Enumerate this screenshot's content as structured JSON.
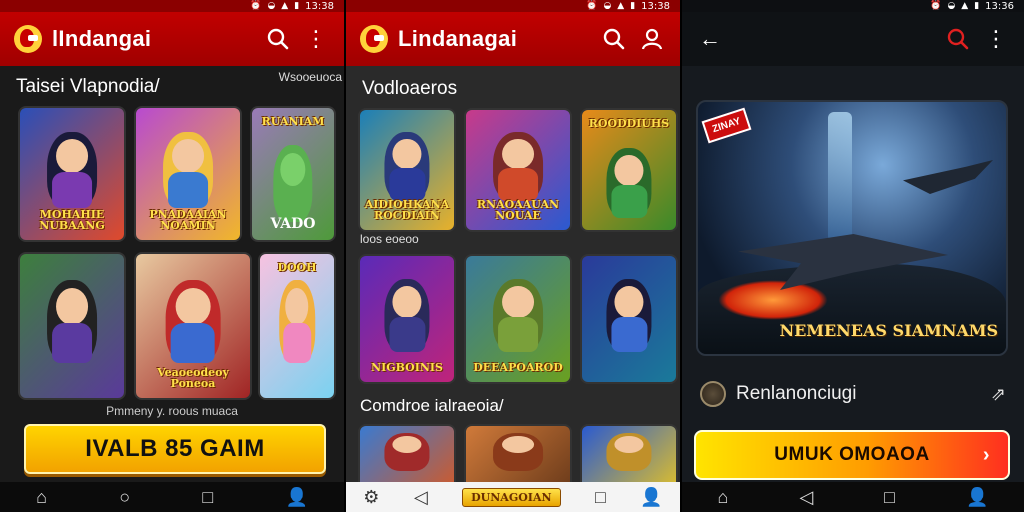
{
  "screen1": {
    "status_time": "13:38",
    "app_title": "lIndangai",
    "section_title": "Taisei Vlapnodia/",
    "side_label": "Wsooeuoca",
    "tiles": [
      {
        "title": "MOHAHIE NUBAANG",
        "colors": [
          "#2a4fb8",
          "#e04a2b"
        ]
      },
      {
        "title": "PNADAAIAN NOAMIN",
        "colors": [
          "#b84ad0",
          "#f1b72a"
        ]
      },
      {
        "title": "RUANIAM",
        "colors": [
          "#9a7ab8",
          "#4e9a3a"
        ]
      },
      {
        "title": "",
        "colors": [
          "#3d7f3d",
          "#5a3a9a"
        ]
      },
      {
        "title": "Veaoeodeoy Poneoa",
        "colors": [
          "#e8c9a0",
          "#a02424"
        ]
      },
      {
        "title": "DOOH",
        "colors": [
          "#f7c2e0",
          "#7ad2f0"
        ]
      }
    ],
    "tile3_extra": "VADO",
    "caption": "Pmmeny y. roous muaca",
    "cta_label": "IVALB 85 GAIM"
  },
  "screen2": {
    "status_time": "13:38",
    "app_title": "Lindanagai",
    "section_title": "Vodloaeros",
    "subsection_label": "loos eoeoo",
    "row1": [
      {
        "title": "AIDIOHKANA ROCDIAIN",
        "colors": [
          "#1b7fb8",
          "#e8b12a"
        ]
      },
      {
        "title": "RNAOAAUAN NOUAE",
        "colors": [
          "#c83a8a",
          "#2a5ad0"
        ]
      },
      {
        "title": "ROODDIUHS",
        "colors": [
          "#e88a1a",
          "#3a8a2a"
        ]
      }
    ],
    "row2": [
      {
        "title": "NIGBOINIS",
        "colors": [
          "#5a2ab8",
          "#c0247a"
        ]
      },
      {
        "title": "DEEAPOAROD",
        "colors": [
          "#3a7a9a",
          "#6aa020"
        ]
      },
      {
        "title": "",
        "colors": [
          "#2a3a9a",
          "#1a7a9a"
        ]
      }
    ],
    "section2_title": "Comdroe ialraeoia/",
    "row3": [
      {
        "title": "",
        "colors": [
          "#3a7ad0",
          "#d05a2a"
        ]
      },
      {
        "title": "",
        "colors": [
          "#d07a3a",
          "#6a3a1a"
        ]
      },
      {
        "title": "",
        "colors": [
          "#2a5ad0",
          "#e0c02a"
        ]
      }
    ],
    "nav_badge": "DUNAGOIAN"
  },
  "screen3": {
    "status_time": "13:36",
    "hero_badge": "ZINAY",
    "hero_title": "NEMENEAS SIAMNAMS",
    "info_name": "Renlanonciugi",
    "cta_label": "UMUK OMOAOA"
  }
}
